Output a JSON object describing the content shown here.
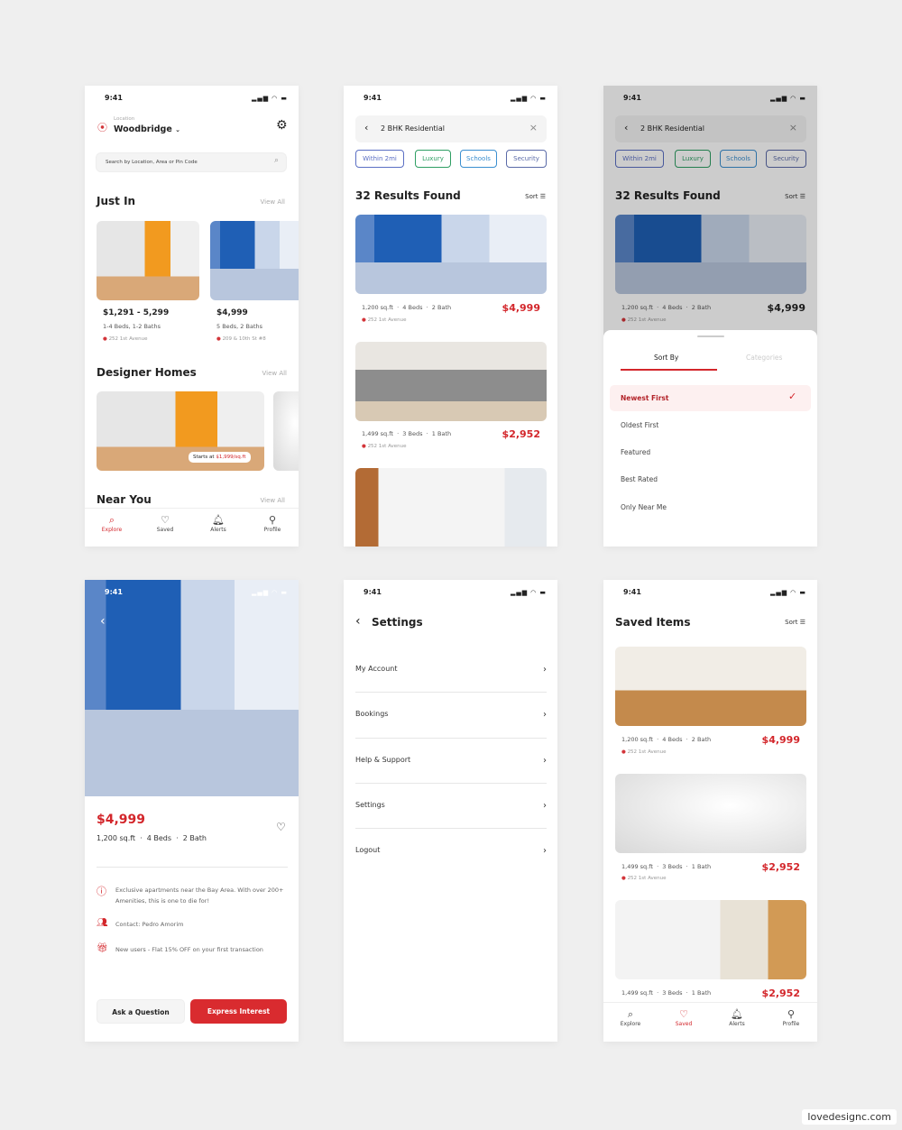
{
  "colors": {
    "accent": "#d3262b",
    "background": "#efefef"
  },
  "status_time": "9:41",
  "status_icons": "signal wifi battery",
  "home": {
    "location_label": "Location",
    "location": "Woodbridge",
    "search_placeholder": "Search by Location, Area or Pin Code",
    "just_in": "Just In",
    "view_all": "View All",
    "cards": [
      {
        "price": "$1,291 - 5,299",
        "beds": "1-4 Beds, 1-2 Baths",
        "address": "252 1st Avenue"
      },
      {
        "price": "$4,999",
        "beds": "5 Beds, 2 Baths",
        "address": "209 & 10th St #8"
      }
    ],
    "designer_homes": "Designer Homes",
    "starts_at": "Starts at",
    "starts_price": "$1,999/sq.ft",
    "near_you": "Near You"
  },
  "tabs": [
    {
      "label": "Explore",
      "icon": "search-icon"
    },
    {
      "label": "Saved",
      "icon": "heart-icon"
    },
    {
      "label": "Alerts",
      "icon": "bell-icon"
    },
    {
      "label": "Profile",
      "icon": "user-icon"
    }
  ],
  "search": {
    "query": "2 BHK Residential",
    "chips": [
      {
        "label": "Within 2mi",
        "color": "#5b6fc4"
      },
      {
        "label": "Luxury",
        "color": "#2e9e63"
      },
      {
        "label": "Schools",
        "color": "#3b8fd0"
      },
      {
        "label": "Security",
        "color": "#5a6aa8"
      }
    ],
    "results": "32 Results Found",
    "sort": "Sort",
    "listings": [
      {
        "specs": "1,200 sq.ft  ·  4 Beds  ·  2 Bath",
        "price": "$4,999",
        "address": "252 1st Avenue"
      },
      {
        "specs": "1,499 sq.ft  ·  3 Beds  ·  1 Bath",
        "price": "$2,952",
        "address": "252 1st Avenue"
      }
    ]
  },
  "sheet": {
    "tab_sort": "Sort By",
    "tab_categories": "Categories",
    "options": [
      "Newest First",
      "Oldest First",
      "Featured",
      "Best Rated",
      "Only Near Me"
    ],
    "selected": "Newest First"
  },
  "detail": {
    "price": "$4,999",
    "specs": "1,200 sq.ft  ·  4 Beds  ·  2 Bath",
    "info": "Exclusive apartments near the Bay Area. With over 200+ Amenities, this is one to die for!",
    "contact": "Contact: Pedro Amorim",
    "offer": "New users - Flat 15% OFF on your first transaction",
    "ask": "Ask a Question",
    "express": "Express Interest"
  },
  "settings": {
    "title": "Settings",
    "items": [
      "My Account",
      "Bookings",
      "Help & Support",
      "Settings",
      "Logout"
    ]
  },
  "saved": {
    "title": "Saved Items",
    "sort": "Sort",
    "listings": [
      {
        "specs": "1,200 sq.ft  ·  4 Beds  ·  2 Bath",
        "price": "$4,999",
        "address": "252 1st Avenue"
      },
      {
        "specs": "1,499 sq.ft  ·  3 Beds  ·  1 Bath",
        "price": "$2,952",
        "address": "252 1st Avenue"
      },
      {
        "specs": "1,499 sq.ft  ·  3 Beds  ·  1 Bath",
        "price": "$2,952"
      }
    ]
  },
  "watermark": "lovedesignc.com"
}
